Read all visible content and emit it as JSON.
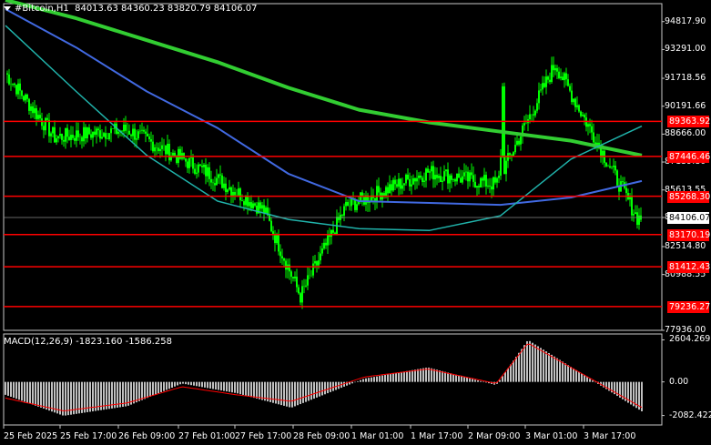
{
  "header": {
    "symbol_line": "#Bitcoin,H1  84013.63 84360.23 83820.79 84106.07"
  },
  "macd_header": {
    "label": "MACD(12,26,9) -1823.160 -1586.258"
  },
  "colors": {
    "background": "#000000",
    "bull_candle": "#00ff00",
    "sr_line": "#ff0000",
    "ma_fast": "#4169e1",
    "ma_mid": "#20b2aa",
    "ma_slow": "#32cd32",
    "macd_hist": "#c0c0c0",
    "macd_signal": "#ff0000"
  },
  "price_axis": {
    "labels": [
      "94817.90",
      "93291.00",
      "91718.56",
      "90191.66",
      "88666.00",
      "87139.80",
      "85613.55",
      "84106.07",
      "82514.80",
      "80988.55",
      "77936.00"
    ]
  },
  "levels": [
    {
      "value": 89363.92,
      "label": "89363.92"
    },
    {
      "value": 87446.46,
      "label": "87446.46"
    },
    {
      "value": 85268.3,
      "label": "85268.30"
    },
    {
      "value": 83170.19,
      "label": "83170.19"
    },
    {
      "value": 81412.43,
      "label": "81412.43"
    },
    {
      "value": 79236.27,
      "label": "79236.27"
    }
  ],
  "current_price": {
    "value": 84106.07,
    "label": "84106.07"
  },
  "macd_axis": {
    "labels": [
      "2604.269",
      "0.00",
      "-2082.422"
    ]
  },
  "time_axis": {
    "labels": [
      "25 Feb 2025",
      "25 Feb 17:00",
      "26 Feb 09:00",
      "27 Feb 01:00",
      "27 Feb 17:00",
      "28 Feb 09:00",
      "1 Mar 01:00",
      "1 Mar 17:00",
      "2 Mar 09:00",
      "3 Mar 01:00",
      "3 Mar 17:00"
    ]
  },
  "chart_data": {
    "type": "line",
    "timeframe": "H1",
    "ylim": [
      77936,
      95800
    ],
    "price_series": {
      "name": "#Bitcoin",
      "x": [
        "25 Feb 2025",
        "25 Feb 17:00",
        "26 Feb 09:00",
        "27 Feb 01:00",
        "27 Feb 17:00",
        "28 Feb 09:00",
        "1 Mar 01:00",
        "1 Mar 17:00",
        "2 Mar 09:00",
        "3 Mar 01:00",
        "3 Mar 17:00"
      ],
      "close": [
        92000,
        88500,
        88900,
        86500,
        84500,
        79800,
        84700,
        86600,
        85900,
        92500,
        84100
      ]
    },
    "moving_averages": [
      {
        "color": "green",
        "values": [
          96000,
          95000,
          93800,
          92600,
          91200,
          90000,
          89300,
          88800,
          88300,
          87500
        ]
      },
      {
        "color": "blue",
        "values": [
          95500,
          93400,
          91000,
          89000,
          86500,
          85000,
          84900,
          84800,
          85200,
          86100
        ]
      },
      {
        "color": "teal",
        "values": [
          94600,
          91000,
          87500,
          85000,
          84000,
          83500,
          83400,
          84200,
          87300,
          89100
        ]
      }
    ],
    "macd": {
      "ylim": [
        -2500,
        2800
      ],
      "histogram": [
        -800,
        -2100,
        -1500,
        -100,
        -700,
        -1600,
        200,
        900,
        -200,
        2600,
        -1823
      ],
      "signal": [
        -1000,
        -1800,
        -1300,
        -300,
        -800,
        -1200,
        300,
        800,
        -100,
        2400,
        -1586
      ]
    }
  }
}
